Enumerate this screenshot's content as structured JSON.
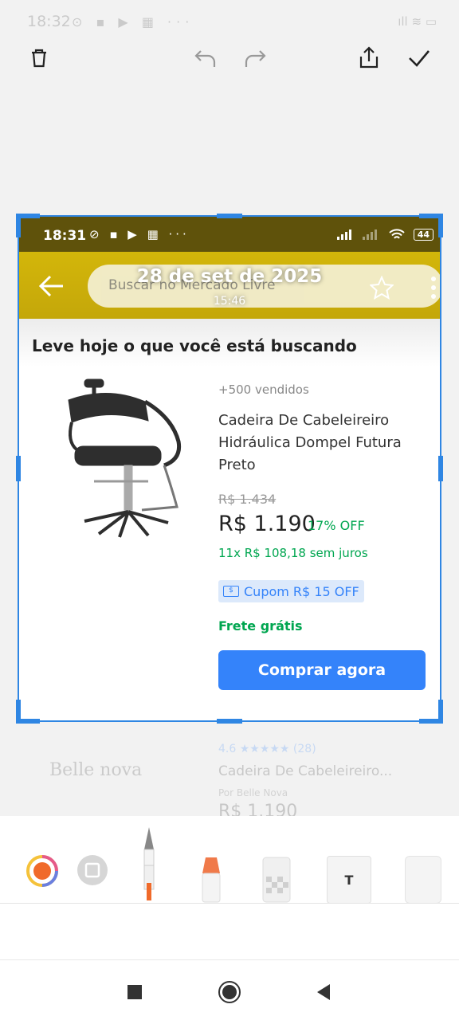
{
  "outer_status": {
    "time": "18:32",
    "left_icons": "⊙ ▪ ▶ ▦ ···",
    "right_icons": "ıll ≋ ▭"
  },
  "editor_toolbar": {
    "delete": "trash-icon",
    "undo": "undo-icon",
    "redo": "redo-icon",
    "share": "share-icon",
    "confirm": "check-icon"
  },
  "screenshot": {
    "status_time": "18:31",
    "status_icons": "⊘ ▪ ▶ ▦ ···",
    "battery": "44",
    "search_placeholder": "Buscar no Mercado Livre",
    "date_stamp": "28 de set de 2025",
    "time_stamp": "15:46",
    "heading": "Leve hoje o que você está buscando",
    "product": {
      "sold": "+500 vendidos",
      "title": "Cadeira De Cabeleireiro Hidráulica Dompel Futura Preto",
      "old_price": "R$ 1.434",
      "price": "R$ 1.190",
      "discount": "17% OFF",
      "installments": "11x R$ 108,18 sem juros",
      "coupon": "Cupom R$ 15 OFF",
      "shipping": "Frete grátis",
      "buy_button": "Comprar agora"
    },
    "colors": {
      "header_yellow": "#d3b60a",
      "accent_blue": "#3483fa",
      "green": "#00a650",
      "crop_border": "#2f86e3"
    }
  },
  "background_listing": {
    "brand": "Belle nova",
    "rating_count": "4.6 ★★★★★ (28)",
    "title": "Cadeira De Cabeleireiro...",
    "seller": "Por Belle Nova",
    "price": "R$ 1.190"
  },
  "tools": [
    "color-picker",
    "shape-tool",
    "pen-tool",
    "marker-tool",
    "mosaic-tool",
    "text-tool",
    "eraser-tool"
  ],
  "tools_text_label": "T",
  "navigation": [
    "recent-apps",
    "home",
    "back"
  ]
}
